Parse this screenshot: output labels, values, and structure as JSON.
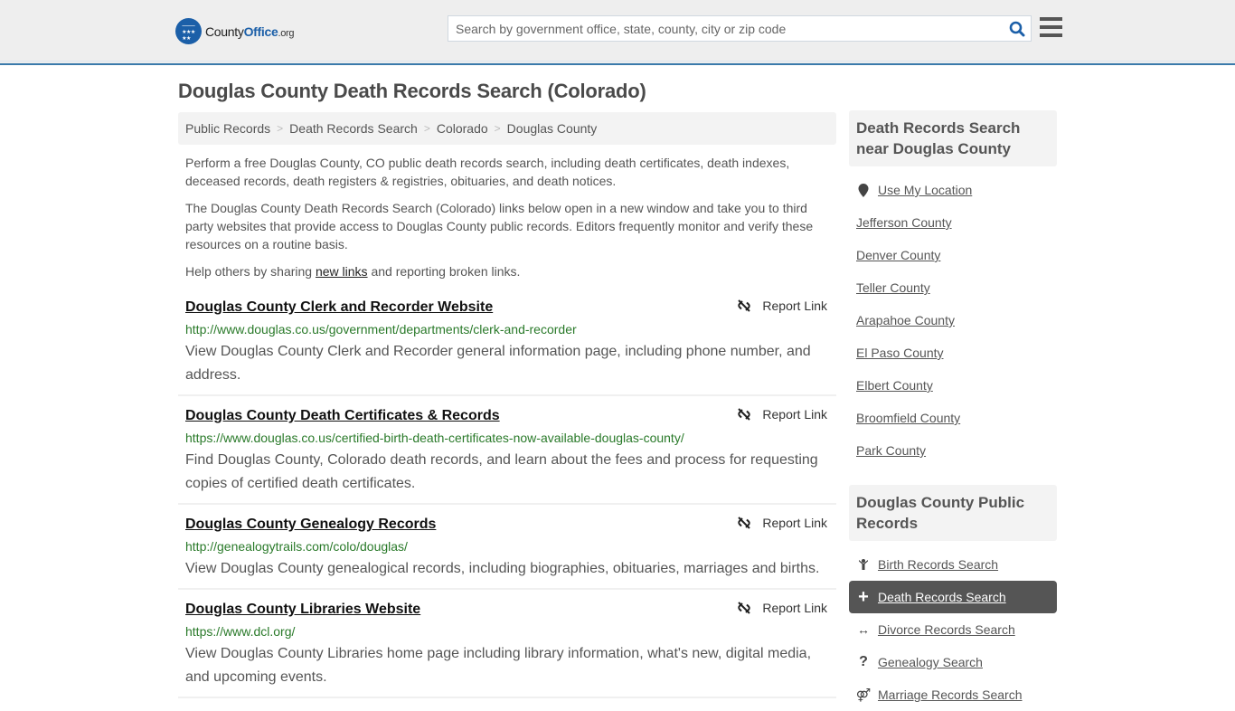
{
  "header": {
    "logo": {
      "name_part1": "County",
      "name_part2": "Office",
      "name_part3": ".org"
    },
    "search": {
      "placeholder": "Search by government office, state, county, city or zip code",
      "value": ""
    },
    "colors": {
      "brand": "#1b5fa8",
      "header_border": "#3a7aab"
    }
  },
  "page": {
    "title": "Douglas County Death Records Search (Colorado)",
    "breadcrumb": [
      "Public Records",
      "Death Records Search",
      "Colorado",
      "Douglas County"
    ],
    "intro": {
      "p1": "Perform a free Douglas County, CO public death records search, including death certificates, death indexes, deceased records, death registers & registries, obituaries, and death notices.",
      "p2": "The Douglas County Death Records Search (Colorado) links below open in a new window and take you to third party websites that provide access to Douglas County public records. Editors frequently monitor and verify these resources on a routine basis.",
      "p3_before": "Help others by sharing ",
      "p3_link": "new links",
      "p3_after": " and reporting broken links."
    }
  },
  "results": [
    {
      "title": "Douglas County Clerk and Recorder Website",
      "url": "http://www.douglas.co.us/government/departments/clerk-and-recorder",
      "description": "View Douglas County Clerk and Recorder general information page, including phone number, and address.",
      "report_label": "Report Link"
    },
    {
      "title": "Douglas County Death Certificates & Records",
      "url": "https://www.douglas.co.us/certified-birth-death-certificates-now-available-douglas-county/",
      "description": "Find Douglas County, Colorado death records, and learn about the fees and process for requesting copies of certified death certificates.",
      "report_label": "Report Link"
    },
    {
      "title": "Douglas County Genealogy Records",
      "url": "http://genealogytrails.com/colo/douglas/",
      "description": "View Douglas County genealogical records, including biographies, obituaries, marriages and births.",
      "report_label": "Report Link"
    },
    {
      "title": "Douglas County Libraries Website",
      "url": "https://www.dcl.org/",
      "description": "View Douglas County Libraries home page including library information, what's new, digital media, and upcoming events.",
      "report_label": "Report Link"
    }
  ],
  "sidebar": {
    "nearby": {
      "heading": "Death Records Search near Douglas County",
      "use_location": "Use My Location",
      "counties": [
        "Jefferson County",
        "Denver County",
        "Teller County",
        "Arapahoe County",
        "El Paso County",
        "Elbert County",
        "Broomfield County",
        "Park County"
      ]
    },
    "public_records": {
      "heading": "Douglas County Public Records",
      "items": [
        {
          "label": "Birth Records Search",
          "icon": "baby-icon",
          "glyph": "὇6",
          "active": false
        },
        {
          "label": "Death Records Search",
          "icon": "cross-icon",
          "glyph": "+",
          "active": true
        },
        {
          "label": "Divorce Records Search",
          "icon": "arrows-horizontal-icon",
          "glyph": "↔",
          "active": false
        },
        {
          "label": "Genealogy Search",
          "icon": "question-icon",
          "glyph": "?",
          "active": false
        },
        {
          "label": "Marriage Records Search",
          "icon": "marriage-icon",
          "glyph": "⚤",
          "active": false
        }
      ]
    }
  }
}
